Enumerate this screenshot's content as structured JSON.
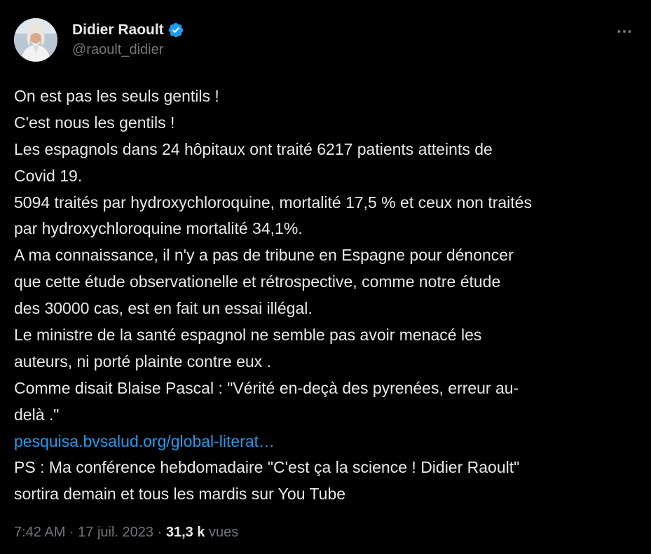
{
  "author": {
    "display_name": "Didier Raoult",
    "handle": "@raoult_didier",
    "verified_icon": "verified-badge-icon",
    "accent": "#1d9bf0"
  },
  "more_icon": "more-horizontal-icon",
  "body": {
    "lines": [
      "On est pas les seuls gentils !",
      "C'est nous les gentils !",
      "Les espagnols dans 24 hôpitaux ont traité 6217 patients atteints de",
      "Covid 19.",
      "5094 traités par hydroxychloroquine, mortalité 17,5 % et ceux non traités",
      "par hydroxychloroquine mortalité 34,1%.",
      "A ma connaissance, il n'y a pas de tribune en Espagne pour dénoncer",
      "que cette étude observationelle et rétrospective, comme notre étude",
      "des 30000 cas, est en fait un essai illégal.",
      "Le ministre de la santé espagnol ne semble pas avoir menacé les",
      "auteurs, ni porté plainte contre eux .",
      "Comme disait Blaise Pascal : \"Vérité en-deçà des pyrenées, erreur au-",
      "delà .\""
    ],
    "link": "pesquisa.bvsalud.org/global-literat…",
    "after_lines": [
      "PS : Ma conférence hebdomadaire \"C'est ça la science ! Didier Raoult\"",
      "sortira demain et tous les mardis sur You Tube"
    ]
  },
  "meta": {
    "time": "7:42 AM",
    "separator": " · ",
    "date": "17 juil. 2023",
    "views_count": "31,3 k",
    "views_label": "vues"
  },
  "colors": {
    "background": "#000000",
    "text": "#e7e9ea",
    "secondary": "#71767b",
    "link": "#1d9bf0"
  }
}
